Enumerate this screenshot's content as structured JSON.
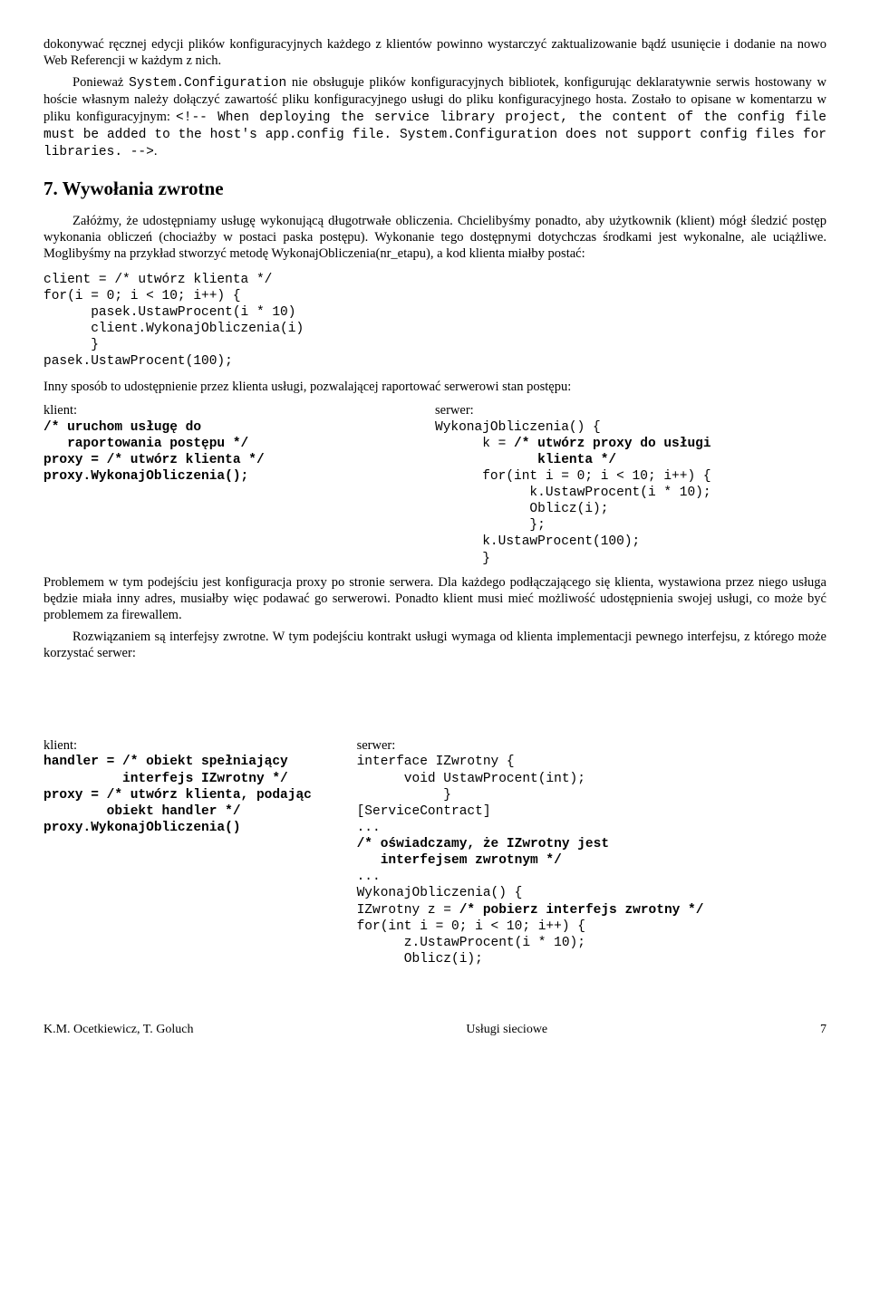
{
  "para1": "dokonywać ręcznej edycji plików konfiguracyjnych każdego z klientów powinno wystarczyć zaktualizowanie bądź usunięcie i dodanie na nowo Web Referencji w każdym z nich.",
  "para2a": "Ponieważ ",
  "para2code": "System.Configuration",
  "para2b": " nie obsługuje plików konfiguracyjnych bibliotek, konfigurując deklaratywnie serwis hostowany w hoście własnym należy dołączyć zawartość pliku konfiguracyjnego usługi do pliku konfiguracyjnego hosta. Zostało to opisane w komentarzu w pliku konfiguracyjnym: ",
  "para2comment": "<!-- When deploying the service library project, the content of the config file must be added to the host's app.config file. System.Configuration does not support config files for libraries. -->",
  "para2c": ".",
  "heading": "7. Wywołania zwrotne",
  "para3": "Załóżmy, że udostępniamy usługę wykonującą długotrwałe obliczenia. Chcielibyśmy ponadto, aby użytkownik (klient) mógł śledzić postęp wykonania obliczeń (chociażby w postaci paska postępu). Wykonanie tego dostępnymi dotychczas środkami jest wykonalne, ale uciążliwe. Moglibyśmy na przykład stworzyć metodę WykonajObliczenia(nr_etapu), a kod klienta miałby postać:",
  "code1": "client = /* utwórz klienta */\nfor(i = 0; i < 10; i++) {\n      pasek.UstawProcent(i * 10)\n      client.WykonajObliczenia(i)\n      }\npasek.UstawProcent(100);",
  "para4": "Inny sposób to udostępnienie przez klienta usługi, pozwalającej raportować serwerowi stan postępu:",
  "klient1_label": "klient:",
  "klient1_code": "/* uruchom usługę do\n   raportowania postępu */\nproxy = /* utwórz klienta */\nproxy.WykonajObliczenia();",
  "serwer1_label": "serwer:",
  "serwer1_code": "WykonajObliczenia() {\n      k = /* utwórz proxy do usługi\n             klienta */\n      for(int i = 0; i < 10; i++) {\n            k.UstawProcent(i * 10);\n            Oblicz(i);\n            };\n      k.UstawProcent(100);\n      }",
  "para5": "Problemem w tym podejściu jest konfiguracja proxy po stronie serwera. Dla każdego podłączającego się klienta, wystawiona przez niego usługa będzie miała inny adres, musiałby więc podawać go serwerowi. Ponadto klient musi mieć możliwość udostępnienia swojej usługi, co może być problemem za firewallem.",
  "para6": "Rozwiązaniem są interfejsy zwrotne. W tym podejściu kontrakt usługi wymaga od klienta implementacji pewnego interfejsu, z którego może korzystać serwer:",
  "klient2_label": "klient:",
  "klient2_code": "handler = /* obiekt spełniający\n          interfejs IZwrotny */\nproxy = /* utwórz klienta, podając\n        obiekt handler */\nproxy.WykonajObliczenia()",
  "serwer2_label": "serwer:",
  "serwer2_code": "interface IZwrotny {\n      void UstawProcent(int);\n           }\n[ServiceContract]\n...\n/* oświadczamy, że IZwrotny jest\n   interfejsem zwrotnym */\n...\nWykonajObliczenia() {\nIZwrotny z = /* pobierz interfejs zwrotny */\nfor(int i = 0; i < 10; i++) {\n      z.UstawProcent(i * 10);\n      Oblicz(i);",
  "footer_left": "K.M. Ocetkiewicz, T. Goluch",
  "footer_center": "Usługi sieciowe",
  "footer_right": "7"
}
